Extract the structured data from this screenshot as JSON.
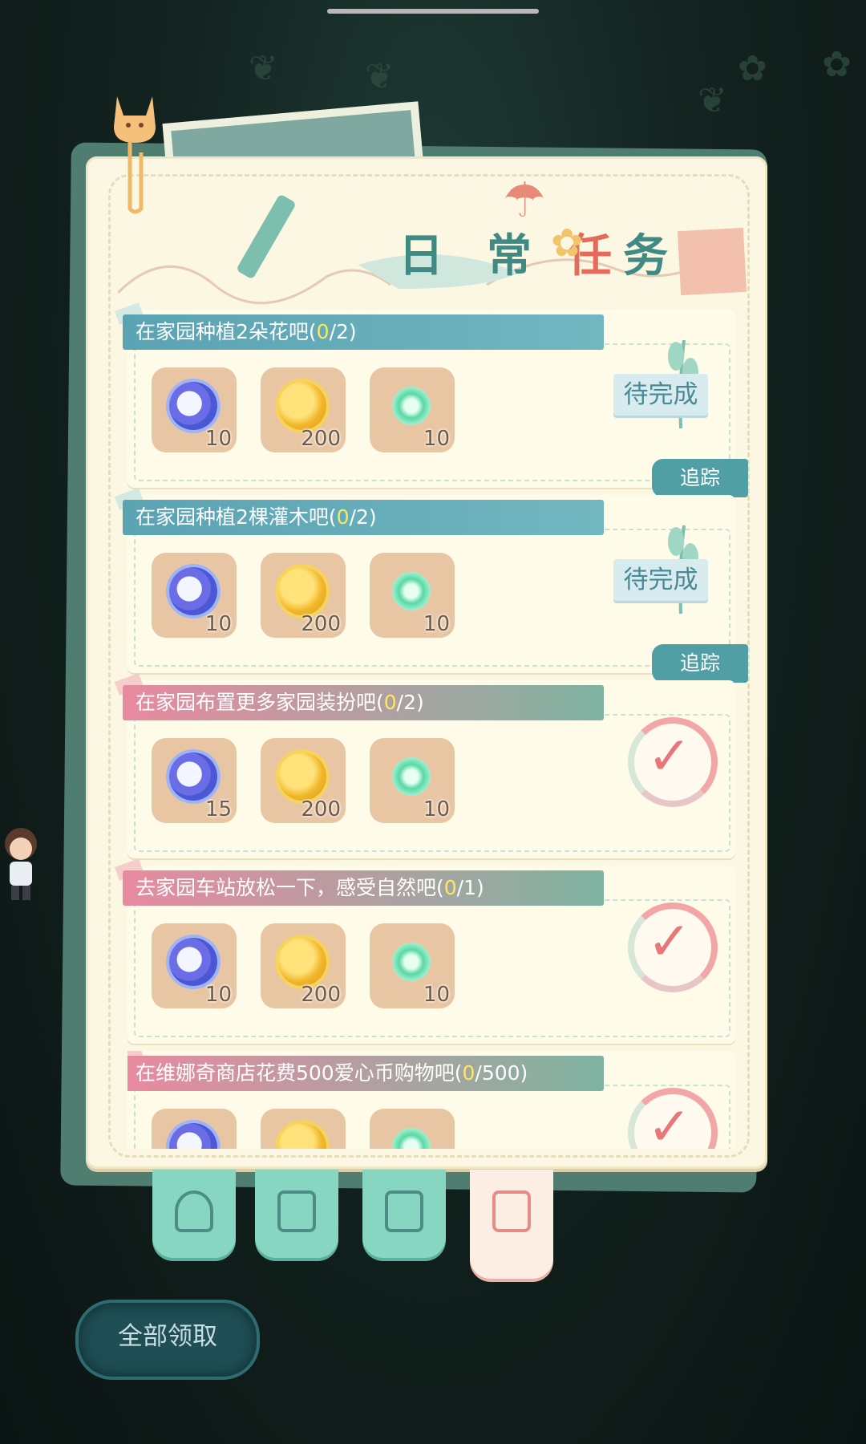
{
  "panel": {
    "title_chars": [
      "日",
      "常",
      "任",
      "务"
    ]
  },
  "labels": {
    "pending": "待完成",
    "track": "追踪"
  },
  "tasks": [
    {
      "prefix": "在家园种植2朵花吧(",
      "done": "0",
      "suffix": "/2)",
      "style": "blue",
      "status": "pending",
      "rewards": {
        "moon": "10",
        "coin": "200",
        "gem": "10"
      }
    },
    {
      "prefix": "在家园种植2棵灌木吧(",
      "done": "0",
      "suffix": "/2)",
      "style": "blue",
      "status": "pending",
      "rewards": {
        "moon": "10",
        "coin": "200",
        "gem": "10"
      }
    },
    {
      "prefix": "在家园布置更多家园装扮吧(",
      "done": "0",
      "suffix": "/2)",
      "style": "pink",
      "status": "check",
      "rewards": {
        "moon": "15",
        "coin": "200",
        "gem": "10"
      }
    },
    {
      "prefix": "去家园车站放松一下，感受自然吧(",
      "done": "0",
      "suffix": "/1)",
      "style": "pink",
      "status": "check",
      "rewards": {
        "moon": "10",
        "coin": "200",
        "gem": "10"
      }
    },
    {
      "prefix": "在维娜奇商店花费500爱心币购物吧(",
      "done": "0",
      "suffix": "/500)",
      "style": "pink",
      "status": "check",
      "rewards": {
        "moon": "",
        "coin": "",
        "gem": ""
      }
    }
  ],
  "tabs": [
    {
      "icon": "wind-icon",
      "active": false
    },
    {
      "icon": "gear-wrench-icon",
      "active": false
    },
    {
      "icon": "paw-card-icon",
      "active": false
    },
    {
      "icon": "task-note-icon",
      "active": true
    }
  ],
  "bottom": {
    "claim_all": "全部领取"
  },
  "colors": {
    "accent_teal": "#4f9fa5",
    "check_pink": "#e9777a",
    "progress_yellow": "#ffe566"
  }
}
